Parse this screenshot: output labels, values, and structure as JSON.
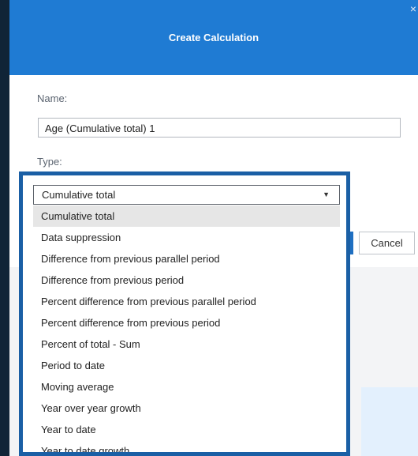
{
  "dialog": {
    "title": "Create Calculation",
    "close_glyph": "×",
    "name_label": "Name:",
    "name_value": "Age (Cumulative total) 1",
    "type_label": "Type:",
    "cancel_label": "Cancel"
  },
  "type_select": {
    "selected": "Cumulative total",
    "caret": "▼",
    "options": [
      "Cumulative total",
      "Data suppression",
      "Difference from previous parallel period",
      "Difference from previous period",
      "Percent difference from previous parallel period",
      "Percent difference from previous period",
      "Percent of total - Sum",
      "Period to date",
      "Moving average",
      "Year over year growth",
      "Year to date",
      "Year to date growth"
    ]
  },
  "colors": {
    "header": "#1f7bd3",
    "highlight_border": "#1a5fa5",
    "background": "#0f1c2a"
  }
}
